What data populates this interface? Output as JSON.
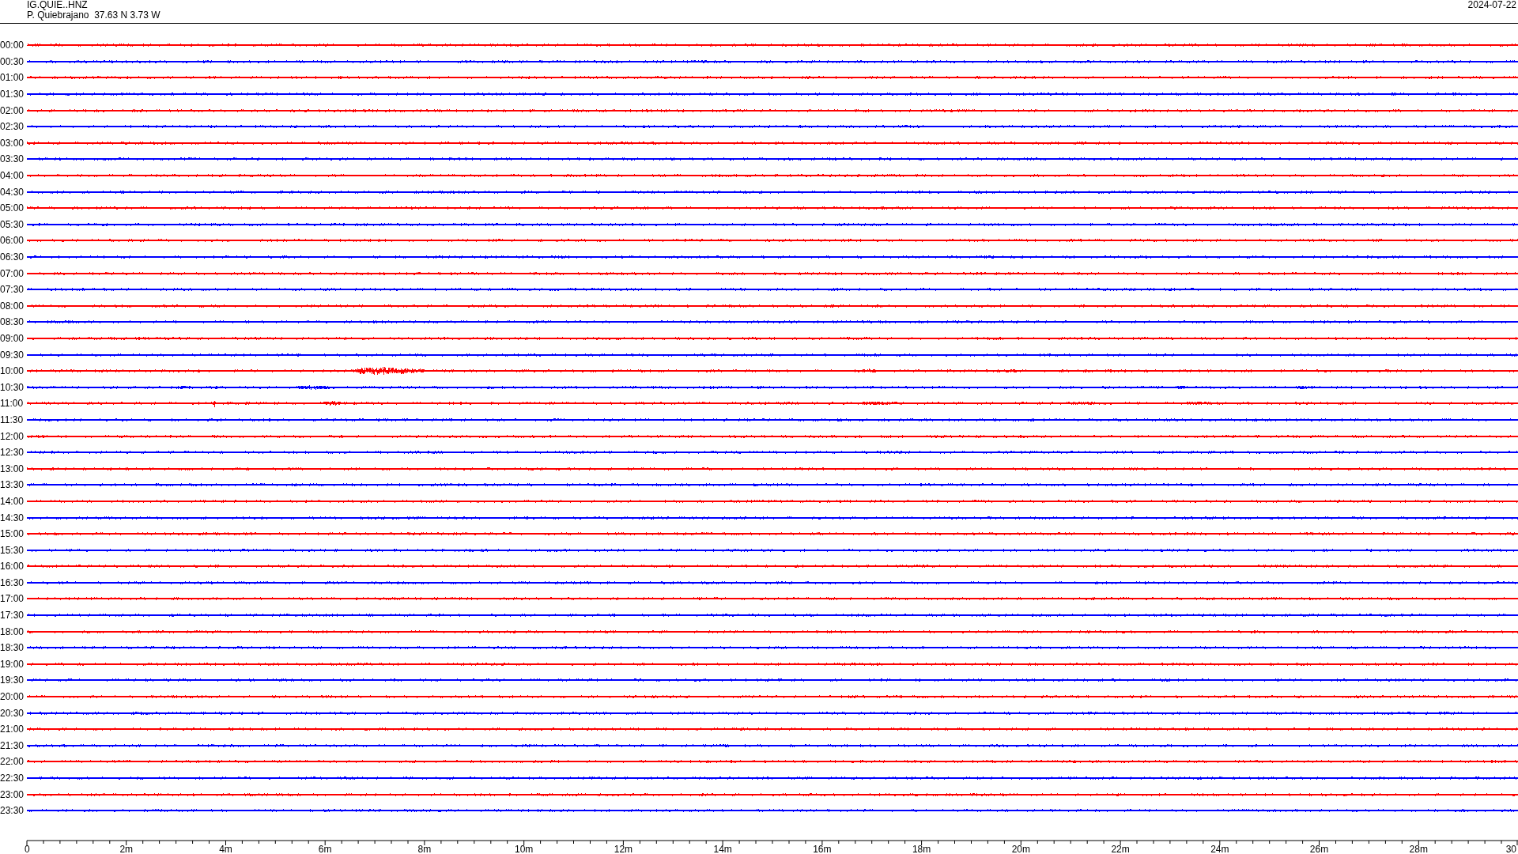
{
  "header": {
    "channel": "IG.QUIE..HNZ",
    "station": "P. Quiebrajano  37.63 N 3.73 W",
    "date": "2024-07-22"
  },
  "rows": [
    {
      "time": "00:00",
      "color": "#ff0000"
    },
    {
      "time": "00:30",
      "color": "#0000ff"
    },
    {
      "time": "01:00",
      "color": "#ff0000"
    },
    {
      "time": "01:30",
      "color": "#0000ff"
    },
    {
      "time": "02:00",
      "color": "#ff0000"
    },
    {
      "time": "02:30",
      "color": "#0000ff"
    },
    {
      "time": "03:00",
      "color": "#ff0000"
    },
    {
      "time": "03:30",
      "color": "#0000ff"
    },
    {
      "time": "04:00",
      "color": "#ff0000"
    },
    {
      "time": "04:30",
      "color": "#0000ff"
    },
    {
      "time": "05:00",
      "color": "#ff0000"
    },
    {
      "time": "05:30",
      "color": "#0000ff"
    },
    {
      "time": "06:00",
      "color": "#ff0000"
    },
    {
      "time": "06:30",
      "color": "#0000ff"
    },
    {
      "time": "07:00",
      "color": "#ff0000"
    },
    {
      "time": "07:30",
      "color": "#0000ff"
    },
    {
      "time": "08:00",
      "color": "#ff0000"
    },
    {
      "time": "08:30",
      "color": "#0000ff"
    },
    {
      "time": "09:00",
      "color": "#ff0000"
    },
    {
      "time": "09:30",
      "color": "#0000ff"
    },
    {
      "time": "10:00",
      "color": "#ff0000"
    },
    {
      "time": "10:30",
      "color": "#0000ff"
    },
    {
      "time": "11:00",
      "color": "#ff0000"
    },
    {
      "time": "11:30",
      "color": "#0000ff"
    },
    {
      "time": "12:00",
      "color": "#ff0000"
    },
    {
      "time": "12:30",
      "color": "#0000ff"
    },
    {
      "time": "13:00",
      "color": "#ff0000"
    },
    {
      "time": "13:30",
      "color": "#0000ff"
    },
    {
      "time": "14:00",
      "color": "#ff0000"
    },
    {
      "time": "14:30",
      "color": "#0000ff"
    },
    {
      "time": "15:00",
      "color": "#ff0000"
    },
    {
      "time": "15:30",
      "color": "#0000ff"
    },
    {
      "time": "16:00",
      "color": "#ff0000"
    },
    {
      "time": "16:30",
      "color": "#0000ff"
    },
    {
      "time": "17:00",
      "color": "#ff0000"
    },
    {
      "time": "17:30",
      "color": "#0000ff"
    },
    {
      "time": "18:00",
      "color": "#ff0000"
    },
    {
      "time": "18:30",
      "color": "#0000ff"
    },
    {
      "time": "19:00",
      "color": "#ff0000"
    },
    {
      "time": "19:30",
      "color": "#0000ff"
    },
    {
      "time": "20:00",
      "color": "#ff0000"
    },
    {
      "time": "20:30",
      "color": "#0000ff"
    },
    {
      "time": "21:00",
      "color": "#ff0000"
    },
    {
      "time": "21:30",
      "color": "#0000ff"
    },
    {
      "time": "22:00",
      "color": "#ff0000"
    },
    {
      "time": "22:30",
      "color": "#0000ff"
    },
    {
      "time": "23:00",
      "color": "#ff0000"
    },
    {
      "time": "23:30",
      "color": "#0000ff"
    }
  ],
  "time_axis": {
    "ticks": [
      "0",
      "2m",
      "4m",
      "6m",
      "8m",
      "10m",
      "12m",
      "14m",
      "16m",
      "18m",
      "20m",
      "22m",
      "24m",
      "26m",
      "28m",
      "30"
    ]
  }
}
